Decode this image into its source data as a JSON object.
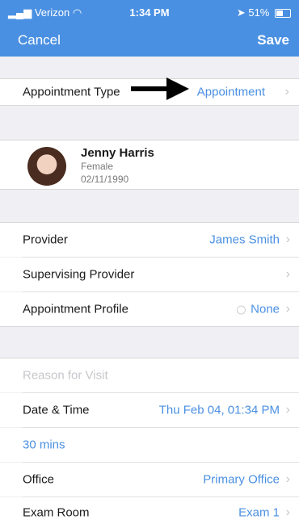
{
  "status_bar": {
    "carrier": "Verizon",
    "time": "1:34 PM",
    "battery": "51%"
  },
  "nav": {
    "cancel": "Cancel",
    "save": "Save"
  },
  "appointment_type": {
    "label": "Appointment Type",
    "value": "Appointment"
  },
  "patient": {
    "name": "Jenny Harris",
    "gender": "Female",
    "dob": "02/11/1990"
  },
  "provider": {
    "label": "Provider",
    "value": "James Smith"
  },
  "supervising_provider": {
    "label": "Supervising Provider",
    "value": ""
  },
  "appointment_profile": {
    "label": "Appointment Profile",
    "value": "None"
  },
  "reason": {
    "placeholder": "Reason for Visit"
  },
  "date_time": {
    "label": "Date & Time",
    "value": "Thu Feb 04, 01:34 PM"
  },
  "duration": {
    "value": "30 mins"
  },
  "office": {
    "label": "Office",
    "value": "Primary Office"
  },
  "exam_room": {
    "label": "Exam Room",
    "value": "Exam 1"
  },
  "colors": {
    "accent": "#4a90e2",
    "background": "#efeff4"
  },
  "icons": [
    "signal-icon",
    "wifi-icon",
    "location-icon",
    "battery-icon",
    "chevron-right-icon",
    "arrow-icon"
  ]
}
